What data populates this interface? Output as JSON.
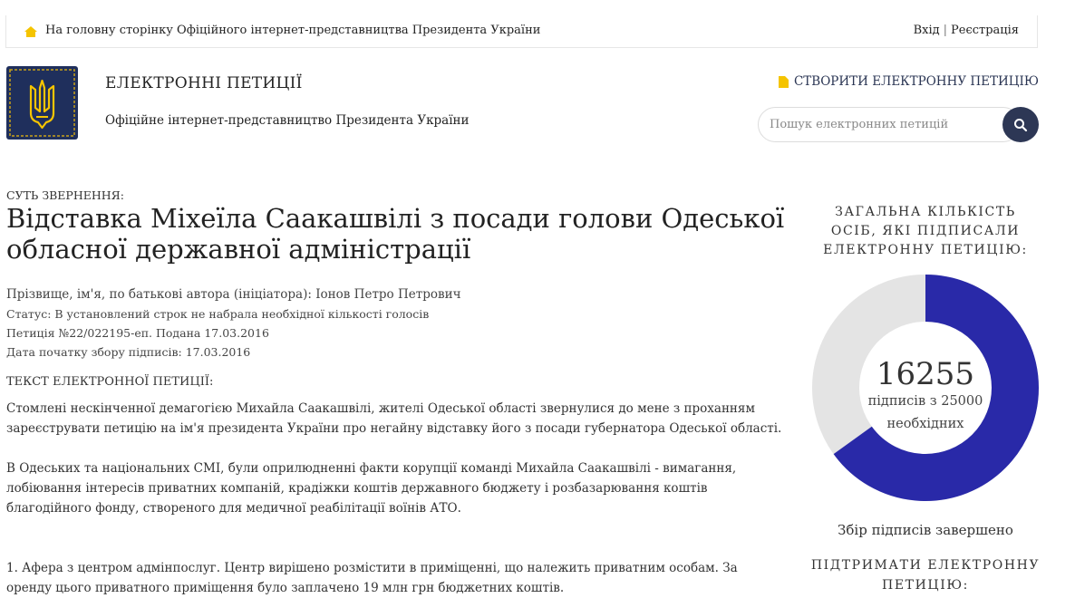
{
  "header": {
    "home_link": "На головну сторінку Офіційного інтернет-представництва Президента України",
    "login": "Вхід",
    "separator": "|",
    "register": "Реєстрація"
  },
  "brand": {
    "title": "ЕЛЕКТРОННІ ПЕТИЦІЇ",
    "subtitle": "Офіційне інтернет-представництво Президента України"
  },
  "actions": {
    "create_petition": "СТВОРИТИ ЕЛЕКТРОННУ ПЕТИЦІЮ",
    "search_placeholder": "Пошук електронних петицій"
  },
  "petition": {
    "essence_label": "СУТЬ ЗВЕРНЕННЯ:",
    "title": "Відставка Міхеїла Саакашвілі з посади голови Одеської обласної державної адміністрації",
    "author": "Прізвище, ім'я, по батькові автора (ініціатора): Іонов Петро Петрович",
    "status": "Статус: В установлений строк не набрала необхідної кількості голосів",
    "number": "Петиція №22/022195-еп. Подана 17.03.2016",
    "start_date": "Дата початку збору підписів: 17.03.2016",
    "text_label": "ТЕКСТ ЕЛЕКТРОННОЇ ПЕТИЦІЇ:",
    "paragraphs": [
      "Стомлені нескінченної демагогією Михайла Саакашвілі, жителі Одеської області звернулися до мене з проханням зареєструвати петицію на ім'я президента України про негайну відставку його з посади губернатора Одеської області.",
      "В Одеських та національних СМІ, були оприлюдненні факти корупції команді Михайла Саакашвілі - вимагання, лобіювання інтересів приватних компаній, крадіжки коштів державного бюджету і розбазарювання коштів благодійного фонду, створеного для медичної реабілітації воїнів АТО.",
      "1. Афера з центром адмінпослуг. Центр вирішено розмістити в приміщенні, що належить приватним особам. За оренду цього приватного приміщення було заплачено 19 млн грн бюджетних коштів."
    ]
  },
  "sidebar": {
    "total_title": "ЗАГАЛЬНА КІЛЬКІСТЬ ОСІБ, ЯКІ ПІДПИСАЛИ ЕЛЕКТРОННУ ПЕТИЦІЮ:",
    "count": "16255",
    "count_sub": "підписів з 25000 необхідних",
    "signatures": 16255,
    "required": 25000,
    "status_done": "Збір підписів завершено",
    "support_title": "ПІДТРИМАТИ ЕЛЕКТРОННУ ПЕТИЦІЮ:"
  },
  "colors": {
    "progress": "#2929a8",
    "track": "#e4e4e4",
    "brand_dark": "#1f2f5c",
    "accent_yellow": "#f5c400"
  },
  "icons": {
    "home": "home-icon",
    "create": "document-icon",
    "search": "search-icon",
    "logo": "trident-emblem"
  }
}
